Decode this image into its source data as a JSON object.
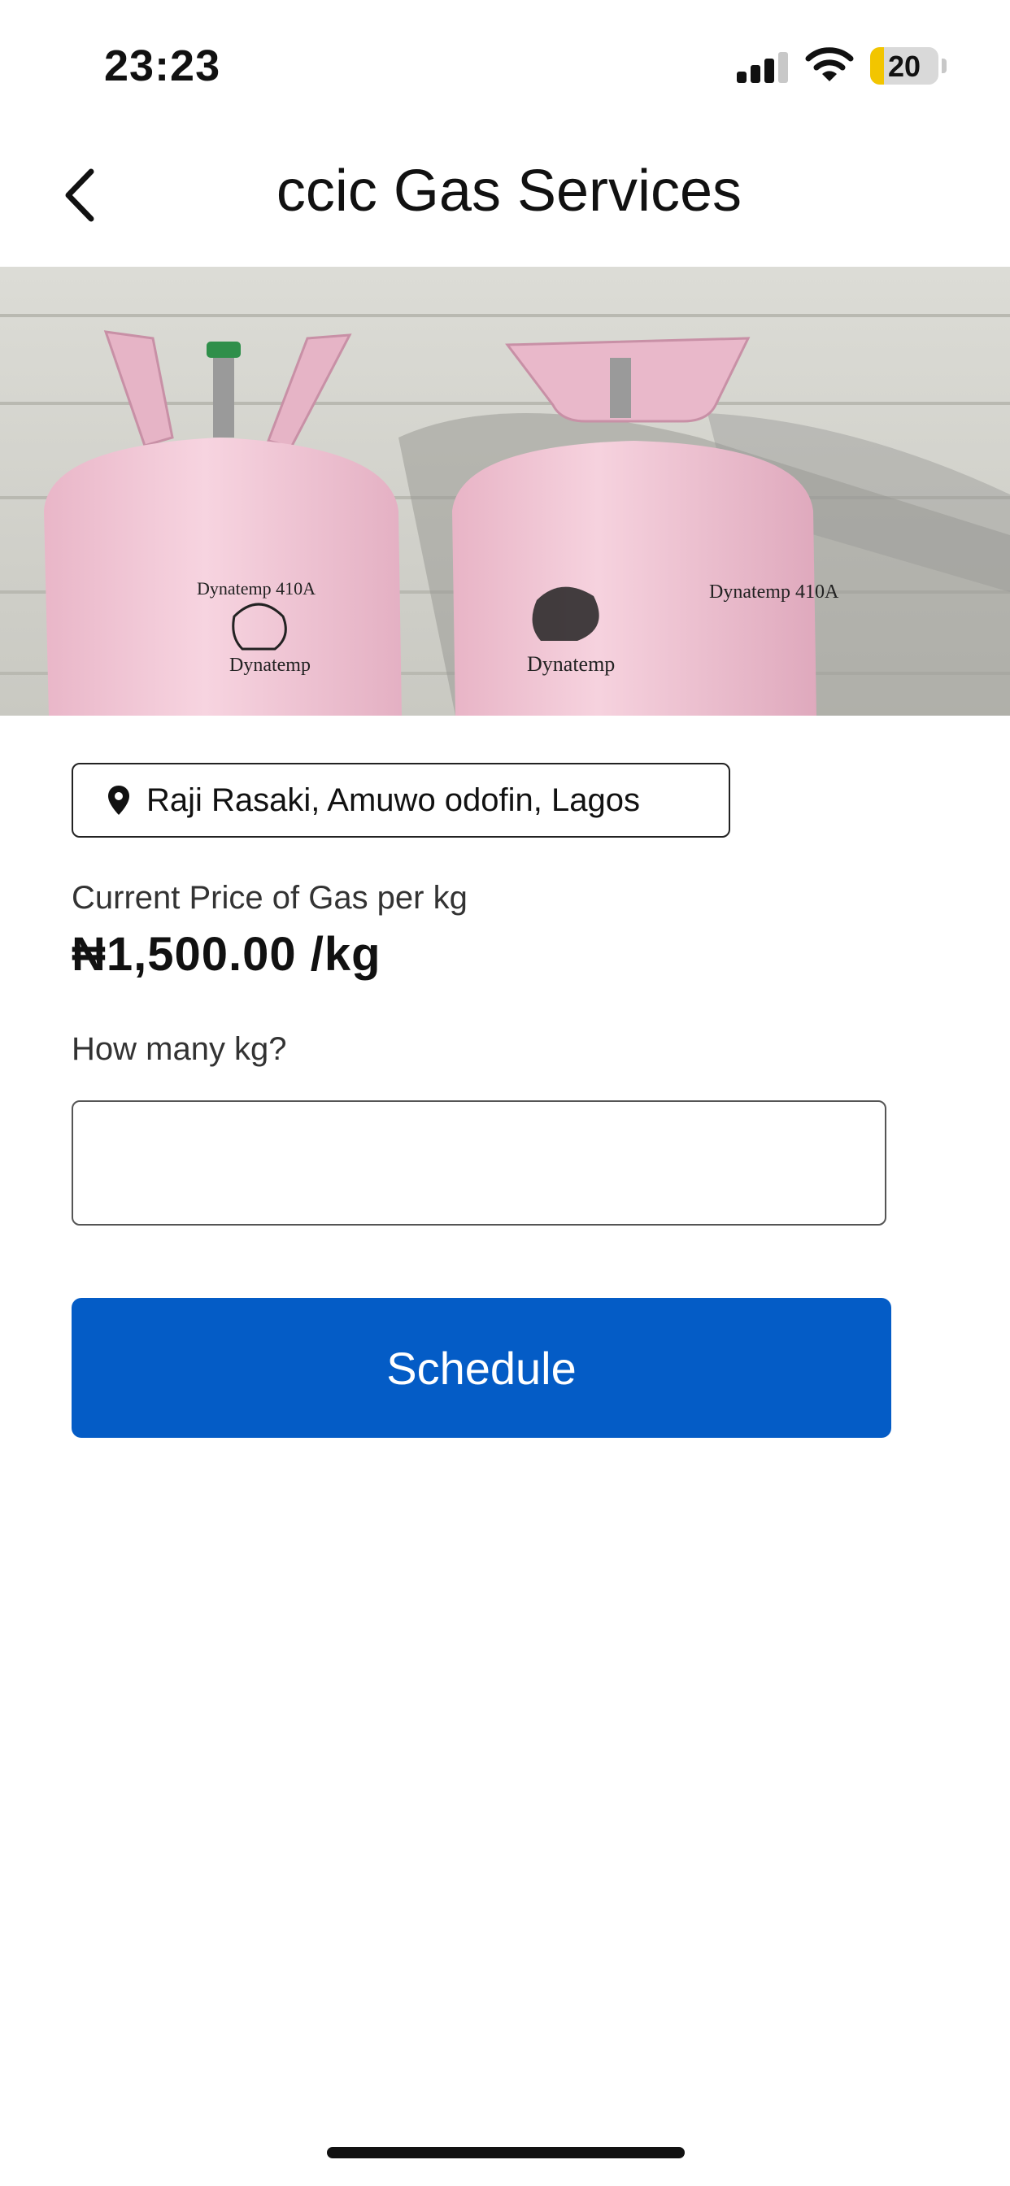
{
  "status_bar": {
    "time": "23:23",
    "battery_level": "20",
    "signal_bars_active": 3,
    "signal_bars_total": 4
  },
  "header": {
    "title": "ccic Gas Services",
    "back_icon": "chevron-left-icon"
  },
  "hero": {
    "image": "gas-cylinders-photo",
    "cylinder_brand": "Dynatemp",
    "cylinder_model": "Dynatemp 410A"
  },
  "location": {
    "icon": "location-pin-icon",
    "text": "Raji Rasaki, Amuwo odofin, Lagos"
  },
  "price": {
    "label": "Current Price of Gas per kg",
    "value": "₦1,500.00 /kg"
  },
  "quantity": {
    "label": "How many kg?",
    "value": "",
    "placeholder": ""
  },
  "actions": {
    "schedule_label": "Schedule"
  },
  "colors": {
    "primary": "#045cc6",
    "battery": "#f2c500",
    "cylinder": "#f2c8d8"
  }
}
